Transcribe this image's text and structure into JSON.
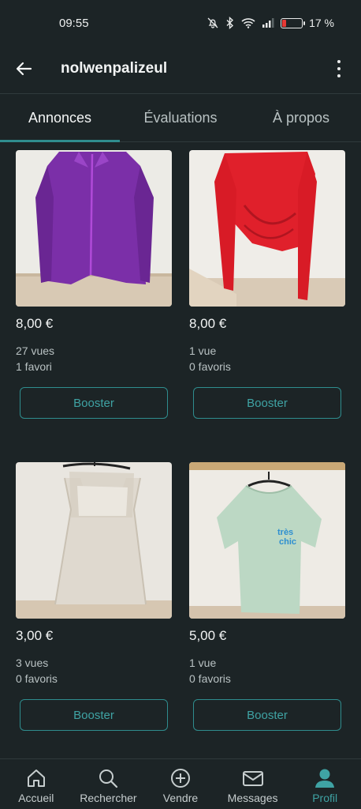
{
  "status": {
    "time": "09:55",
    "battery": "17 %"
  },
  "header": {
    "title": "nolwenpalizeul"
  },
  "tabs": [
    {
      "label": "Annonces",
      "active": true
    },
    {
      "label": "Évaluations",
      "active": false
    },
    {
      "label": "À propos",
      "active": false
    }
  ],
  "listings": [
    {
      "price": "8,00 €",
      "views": "27 vues",
      "favorites": "1 favori",
      "button": "Booster",
      "photo": "purple-fleece-jacket"
    },
    {
      "price": "8,00 €",
      "views": "1 vue",
      "favorites": "0 favoris",
      "button": "Booster",
      "photo": "red-draped-crop-top"
    },
    {
      "price": "3,00 €",
      "views": "3 vues",
      "favorites": "0 favoris",
      "button": "Booster",
      "photo": "beige-lace-tank-top"
    },
    {
      "price": "5,00 €",
      "views": "1 vue",
      "favorites": "0 favoris",
      "button": "Booster",
      "photo": "mint-green-tshirt"
    }
  ],
  "nav": [
    {
      "label": "Accueil",
      "icon": "home-icon"
    },
    {
      "label": "Rechercher",
      "icon": "search-icon"
    },
    {
      "label": "Vendre",
      "icon": "plus-circle-icon"
    },
    {
      "label": "Messages",
      "icon": "mail-icon"
    },
    {
      "label": "Profil",
      "icon": "profile-icon",
      "active": true
    }
  ],
  "colors": {
    "background": "#1c2426",
    "accent": "#2f8d8e",
    "battery_low": "#e53935"
  }
}
